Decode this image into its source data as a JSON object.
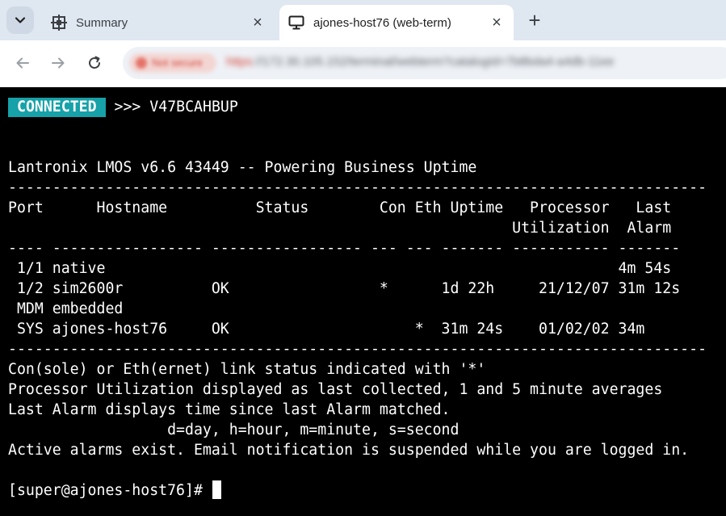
{
  "browser": {
    "tabs": [
      {
        "title": "Summary",
        "icon": "lantronix-logo-icon",
        "active": false
      },
      {
        "title": "ajones-host76 (web-term)",
        "icon": "monitor-icon",
        "active": true
      }
    ],
    "close_glyph": "×",
    "new_tab_glyph": "+",
    "omnibox": {
      "security_chip": "Not secure",
      "url_scheme": "https",
      "url_rest": "://172.30.105.152/terminal/webterm?catalogId=7b8bda4-a4db-11ee"
    }
  },
  "terminal": {
    "connection_status": "CONNECTED",
    "session_info": " >>> V47BCAHBUP",
    "lines": [
      "Lantronix LMOS v6.6 43449 -- Powering Business Uptime",
      "-------------------------------------------------------------------------------",
      "Port      Hostname          Status        Con Eth Uptime   Processor   Last",
      "                                                         Utilization  Alarm",
      "---- ----------------- ----------------- --- --- ------- ----------- -------",
      " 1/1 native                                                          4m 54s",
      " 1/2 sim2600r          OK                 *      1d 22h     21/12/07 31m 12s",
      " MDM embedded",
      " SYS ajones-host76     OK                     *  31m 24s    01/02/02 34m",
      "-------------------------------------------------------------------------------",
      "Con(sole) or Eth(ernet) link status indicated with '*'",
      "Processor Utilization displayed as last collected, 1 and 5 minute averages",
      "Last Alarm displays time since last Alarm matched.",
      "                  d=day, h=hour, m=minute, s=second",
      "Active alarms exist. Email notification is suspended while you are logged in."
    ],
    "prompt": "[super@ajones-host76]# "
  },
  "colors": {
    "terminal_bg": "#000000",
    "badge_bg": "#17a1a8",
    "tabbar_bg": "#dfe7f1"
  }
}
